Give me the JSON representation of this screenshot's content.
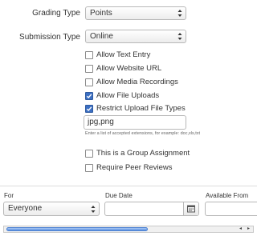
{
  "grading": {
    "label": "Grading Type",
    "value": "Points"
  },
  "submission": {
    "label": "Submission Type",
    "value": "Online"
  },
  "options": [
    {
      "label": "Allow Text Entry",
      "checked": false
    },
    {
      "label": "Allow Website URL",
      "checked": false
    },
    {
      "label": "Allow Media Recordings",
      "checked": false
    },
    {
      "label": "Allow File Uploads",
      "checked": true
    },
    {
      "label": "Restrict Upload File Types",
      "checked": true
    }
  ],
  "extensions": {
    "value": "jpg,png",
    "hint": "Enter a list of accepted extensions, for example: doc,xls,txt"
  },
  "group": {
    "label": "This is a Group Assignment",
    "checked": false
  },
  "peer": {
    "label": "Require Peer Reviews",
    "checked": false
  },
  "assign": {
    "for_label": "For",
    "for_value": "Everyone",
    "due_label": "Due Date",
    "due_value": "",
    "available_label": "Available From",
    "available_value": ""
  },
  "scrollbar": {
    "left_arrow": "◂",
    "right_arrow": "▸"
  }
}
